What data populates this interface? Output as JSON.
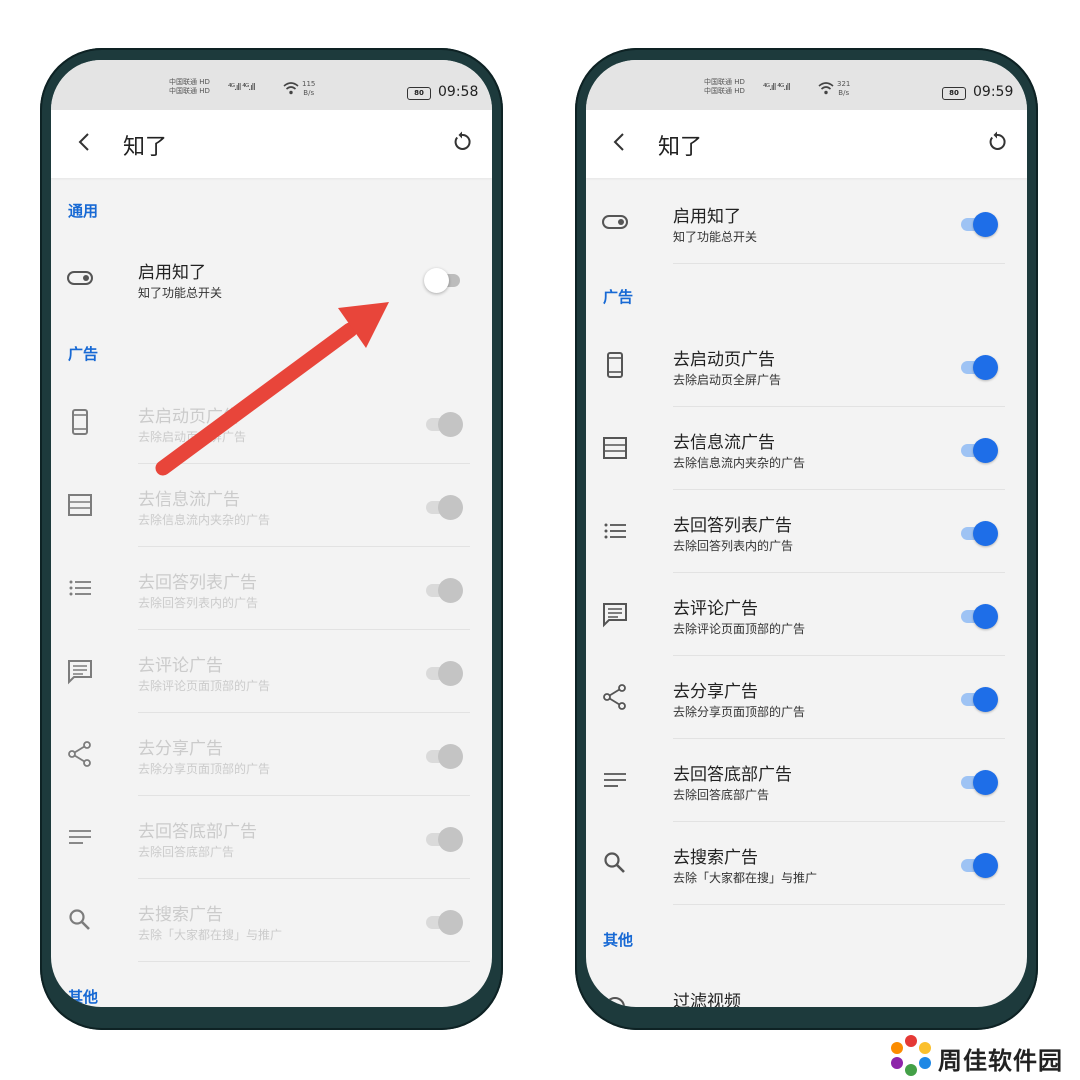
{
  "status_left": {
    "carrier_1": "中国联通 HD",
    "carrier_2": "中国联通 HD",
    "signal": "⁴ᴳ.ıll ⁴ᴳ.ıll",
    "speed_value": "115",
    "speed_unit": "B/s",
    "battery": "80",
    "time": "09:58"
  },
  "status_right": {
    "carrier_1": "中国联通 HD",
    "carrier_2": "中国联通 HD",
    "signal": "⁴ᴳ.ıll ⁴ᴳ.ıll",
    "speed_value": "321",
    "speed_unit": "B/s",
    "battery": "80",
    "time": "09:59"
  },
  "app": {
    "title": "知了"
  },
  "sections": {
    "general": "通用",
    "ads": "广告",
    "other": "其他"
  },
  "settings": {
    "enable": {
      "title": "启用知了",
      "subtitle": "知了功能总开关"
    },
    "splash": {
      "title": "去启动页广告",
      "subtitle": "去除启动页全屏广告"
    },
    "feed": {
      "title": "去信息流广告",
      "subtitle": "去除信息流内夹杂的广告"
    },
    "answer_list": {
      "title": "去回答列表广告",
      "subtitle": "去除回答列表内的广告"
    },
    "comment": {
      "title": "去评论广告",
      "subtitle": "去除评论页面顶部的广告"
    },
    "share": {
      "title": "去分享广告",
      "subtitle": "去除分享页面顶部的广告"
    },
    "answer_bottom": {
      "title": "去回答底部广告",
      "subtitle": "去除回答底部广告"
    },
    "search": {
      "title": "去搜索广告",
      "subtitle": "去除「大家都在搜」与推广"
    },
    "filter_video": {
      "title": "过滤视频"
    }
  },
  "toggle_states": {
    "left_enable": "off",
    "left_ads": "disabled",
    "right_all": "on"
  },
  "colors": {
    "accent": "#1e6ee8",
    "section_label": "#1769d4",
    "arrow": "#e8453a",
    "phone_frame": "#1d3a3c"
  },
  "watermark": {
    "text": "周佳软件园"
  }
}
